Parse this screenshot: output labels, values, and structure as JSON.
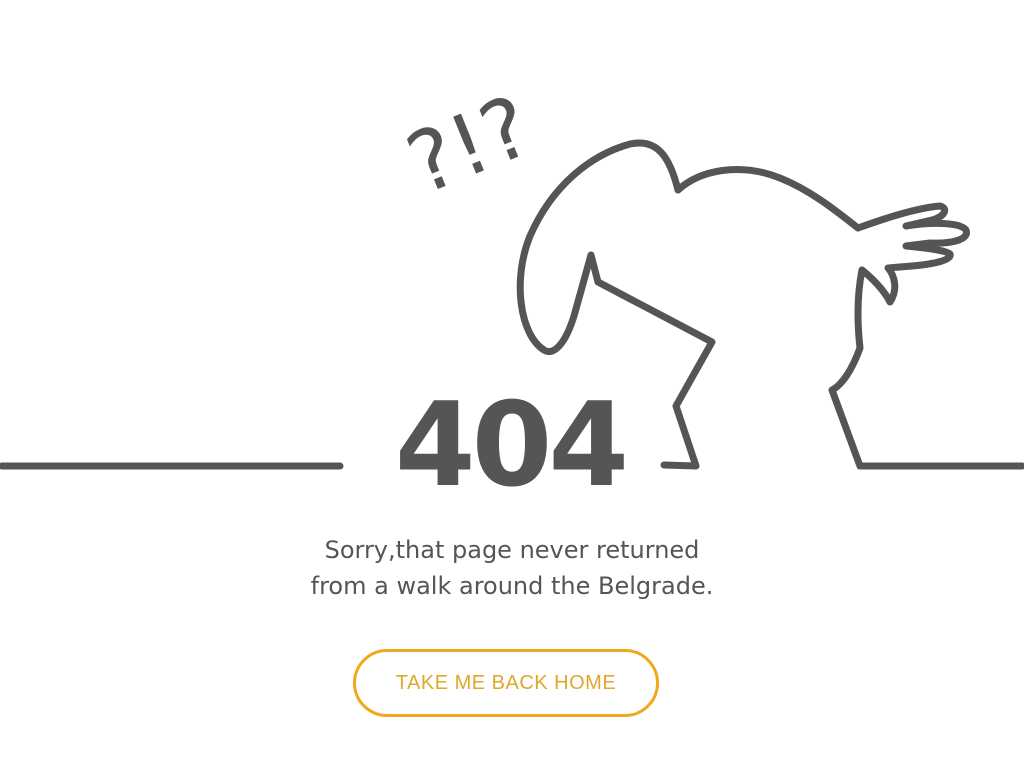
{
  "error": {
    "code": "404",
    "marks": "?!?",
    "message_line1": "Sorry,that page never returned",
    "message_line2": "from a walk around the Belgrade."
  },
  "actions": {
    "home_label": "TAKE ME BACK HOME"
  },
  "colors": {
    "line": "#555555",
    "text": "#555555",
    "accent": "#f0a81c"
  },
  "icons": {
    "illustration": "confused-figure-icon"
  }
}
